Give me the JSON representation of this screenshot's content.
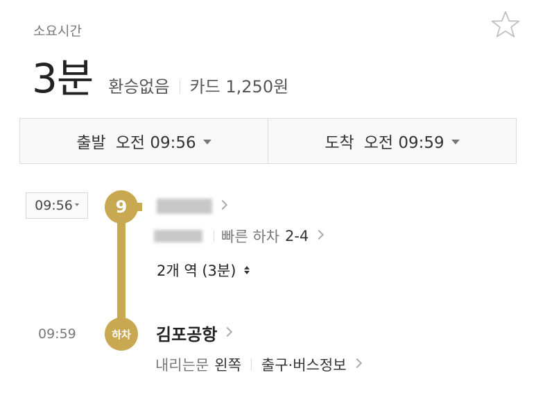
{
  "header": {
    "label": "소요시간",
    "duration": "3분",
    "transfer": "환승없음",
    "fare": "카드 1,250원"
  },
  "time_bar": {
    "departure_label": "출발",
    "departure_value": "오전 09:56",
    "arrival_label": "도착",
    "arrival_value": "오전 09:59"
  },
  "route": {
    "departure_time": "09:56",
    "line_number": "9",
    "fast_exit_label": "빠른 하차",
    "fast_exit_value": "2-4",
    "stops_info": "2개 역 (3분)",
    "arrival_time": "09:59",
    "alight_badge": "하차",
    "arrival_station": "김포공항",
    "door_label": "내리는문",
    "door_value": "왼쪽",
    "exit_bus_info": "출구·버스정보"
  },
  "colors": {
    "line_gold": "#c8a850"
  },
  "icons": {
    "favorite": "star-icon"
  }
}
